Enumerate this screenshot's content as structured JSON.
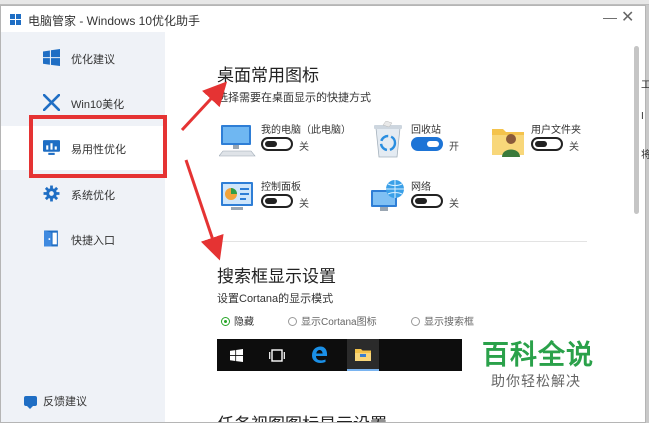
{
  "window": {
    "title": "电脑管家 - Windows 10优化助手",
    "minimize_symbol": "—",
    "close_symbol": "✕"
  },
  "sidebar": {
    "items": [
      {
        "label": "优化建议",
        "icon": "windows-logo-icon",
        "active": false
      },
      {
        "label": "Win10美化",
        "icon": "brush-icon",
        "active": false
      },
      {
        "label": "易用性优化",
        "icon": "monitor-chart-icon",
        "active": true
      },
      {
        "label": "系统优化",
        "icon": "gear-icon",
        "active": false
      },
      {
        "label": "快捷入口",
        "icon": "door-icon",
        "active": false
      }
    ],
    "feedback_label": "反馈建议"
  },
  "desktop_icons": {
    "title": "桌面常用图标",
    "subtitle": "选择需要在桌面显示的快捷方式",
    "items": [
      {
        "name": "我的电脑（此电脑）",
        "state": "关",
        "on": false,
        "icon": "computer-icon"
      },
      {
        "name": "回收站",
        "state": "开",
        "on": true,
        "icon": "recycle-bin-icon"
      },
      {
        "name": "用户文件夹",
        "state": "关",
        "on": false,
        "icon": "user-folder-icon"
      },
      {
        "name": "控制面板",
        "state": "关",
        "on": false,
        "icon": "control-panel-icon"
      },
      {
        "name": "网络",
        "state": "关",
        "on": false,
        "icon": "network-icon"
      }
    ]
  },
  "search_box": {
    "title": "搜索框显示设置",
    "subtitle": "设置Cortana的显示模式",
    "options": [
      {
        "label": "隐藏",
        "checked": true
      },
      {
        "label": "显示Cortana图标",
        "checked": false
      },
      {
        "label": "显示搜索框",
        "checked": false
      }
    ]
  },
  "next_section": {
    "title": "任务视图图标显示设置"
  },
  "background": {
    "peek_chars": [
      "工",
      "I",
      "将"
    ]
  },
  "watermark": {
    "title": "百科全说",
    "subtitle": "助你轻松解决"
  },
  "colors": {
    "accent": "#1d74d6",
    "highlight_red": "#e53333",
    "watermark_green": "#2aa14a"
  }
}
